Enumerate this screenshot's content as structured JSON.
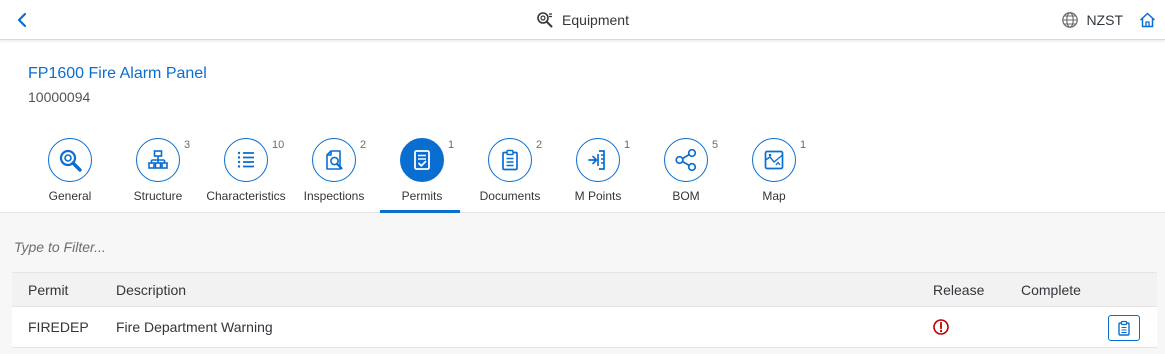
{
  "shell": {
    "title": "Equipment",
    "title_icon": "search-details-icon",
    "back_icon": "nav-back-icon",
    "language": "NZST",
    "language_icon": "globe-icon",
    "home_icon": "home-icon"
  },
  "header": {
    "title": "FP1600 Fire Alarm Panel",
    "id": "10000094"
  },
  "tabs": [
    {
      "label": "General",
      "count": "",
      "icon": "search-icon",
      "selected": false
    },
    {
      "label": "Structure",
      "count": "3",
      "icon": "hierarchy-icon",
      "selected": false
    },
    {
      "label": "Characteristics",
      "count": "10",
      "icon": "list-icon",
      "selected": false
    },
    {
      "label": "Inspections",
      "count": "2",
      "icon": "inspection-icon",
      "selected": false
    },
    {
      "label": "Permits",
      "count": "1",
      "icon": "permit-document-icon",
      "selected": true
    },
    {
      "label": "Documents",
      "count": "2",
      "icon": "clipboard-icon",
      "selected": false
    },
    {
      "label": "M Points",
      "count": "1",
      "icon": "measuring-point-icon",
      "selected": false
    },
    {
      "label": "BOM",
      "count": "5",
      "icon": "share-icon",
      "selected": false
    },
    {
      "label": "Map",
      "count": "1",
      "icon": "map-icon",
      "selected": false
    }
  ],
  "filter": {
    "placeholder": "Type to Filter..."
  },
  "table": {
    "columns": {
      "permit": "Permit",
      "description": "Description",
      "release": "Release",
      "complete": "Complete"
    },
    "rows": [
      {
        "permit": "FIREDEP",
        "description": "Fire Department Warning",
        "release_status_icon": "error-icon",
        "action_icon": "clipboard-icon"
      }
    ]
  },
  "colors": {
    "accent": "#0a6ed1",
    "error": "#bb0000",
    "text": "#32363a",
    "muted": "#6a6d70",
    "content_bg": "#f7f7f7"
  }
}
